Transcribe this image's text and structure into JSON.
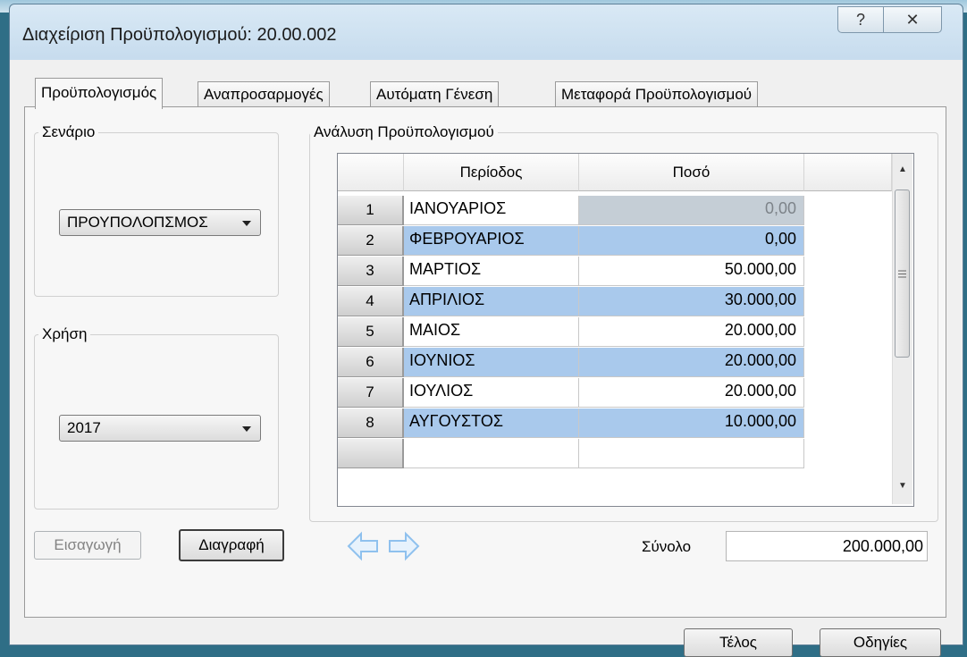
{
  "window": {
    "title": "Διαχείριση Προϋπολογισμού: 20.00.002",
    "help_glyph": "?",
    "close_glyph": "✕"
  },
  "tabs": [
    {
      "label": "Προϋπολογισμός",
      "active": true
    },
    {
      "label": "Αναπροσαρμογές",
      "active": false
    },
    {
      "label": "Αυτόματη Γένεση",
      "active": false
    },
    {
      "label": "Μεταφορά Προϋπολογισμού",
      "active": false
    }
  ],
  "scenario": {
    "legend": "Σενάριο",
    "value": "ΠΡΟΥΠΟΛΟΠΣΜΟΣ"
  },
  "year": {
    "legend": "Χρήση",
    "value": "2017"
  },
  "buttons": {
    "insert": "Εισαγωγή",
    "delete": "Διαγραφή",
    "finish": "Τέλος",
    "help": "Οδηγίες"
  },
  "analysis": {
    "legend": "Ανάλυση Προϋπολογισμού",
    "columns": [
      "Περίοδος",
      "Ποσό"
    ],
    "rows": [
      {
        "n": "1",
        "period": "ΙΑΝΟΥΑΡΙΟΣ",
        "amount": "0,00"
      },
      {
        "n": "2",
        "period": "ΦΕΒΡΟΥΑΡΙΟΣ",
        "amount": "0,00"
      },
      {
        "n": "3",
        "period": "ΜΑΡΤΙΟΣ",
        "amount": "50.000,00"
      },
      {
        "n": "4",
        "period": "ΑΠΡΙΛΙΟΣ",
        "amount": "30.000,00"
      },
      {
        "n": "5",
        "period": "ΜΑΙΟΣ",
        "amount": "20.000,00"
      },
      {
        "n": "6",
        "period": "ΙΟΥΝΙΟΣ",
        "amount": "20.000,00"
      },
      {
        "n": "7",
        "period": "ΙΟΥΛΙΟΣ",
        "amount": "20.000,00"
      },
      {
        "n": "8",
        "period": "ΑΥΓΟΥΣΤΟΣ",
        "amount": "10.000,00"
      }
    ],
    "total_label": "Σύνολο",
    "total_value": "200.000,00"
  },
  "colors": {
    "selected_row": "#a9c9ec",
    "arrow_icon": "#8fc1ee"
  }
}
